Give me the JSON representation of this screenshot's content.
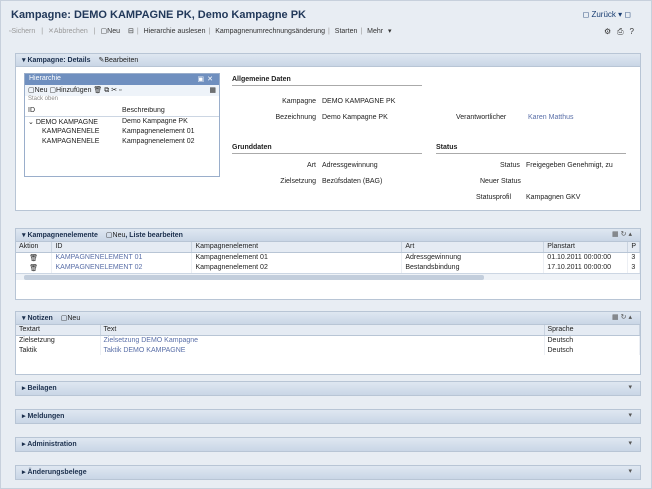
{
  "window": {
    "title": "Kampagne: DEMO KAMPAGNE PK, Demo Kampagne PK",
    "back_label": "Zurück"
  },
  "toolbar": {
    "items": [
      "Sichern",
      "Abbrechen",
      "Neu",
      "Hierarchie auslesen",
      "Kampagnenumrechnungsänderung",
      "Starten",
      "Mehr"
    ],
    "disabled": [
      true,
      true,
      false,
      false,
      false,
      false,
      false
    ]
  },
  "details": {
    "header": "Kampagne: Details",
    "edit": "Bearbeiten",
    "hierarchy": {
      "title": "Hierarchie",
      "new": "Neu",
      "add": "Hinzufügen",
      "stop": "Stack oben",
      "col_id": "ID",
      "col_desc": "Beschreibung",
      "rows": [
        {
          "id": "DEMO KAMPAGNE",
          "desc": "Demo Kampagne PK"
        },
        {
          "id": "KAMPAGNENELE",
          "desc": "Kampagnenelement 01"
        },
        {
          "id": "KAMPAGNENELE",
          "desc": "Kampagnenelement 02"
        }
      ]
    },
    "general": {
      "header": "Allgemeine Daten",
      "campaign_label": "Kampagne",
      "campaign_value": "DEMO KAMPAGNE PK",
      "desc_label": "Bezeichnung",
      "desc_value": "Demo Kampagne PK",
      "resp_label": "Verantwortlicher",
      "resp_value": "Karen Matthus"
    },
    "business": {
      "header": "Grunddaten",
      "type_label": "Art",
      "type_value": "Adressgewinnung",
      "target_label": "Zielsetzung",
      "target_value": "Bezüfsdaten (BAG)"
    },
    "status": {
      "header": "Status",
      "status_label": "Status",
      "status_value": "Freigegeben  Genehmigt, zu",
      "new_label": "Neuer Status",
      "new_value": "",
      "profile_label": "Statusprofil",
      "profile_value": "Kampagnen GKV"
    }
  },
  "elements": {
    "header": "Kampagnenelemente",
    "new": "Neu",
    "edit_list": "Liste bearbeiten",
    "columns": [
      "Aktion",
      "ID",
      "Kampagnenelement",
      "Art",
      "Planstart",
      "P"
    ],
    "rows": [
      {
        "id": "KAMPAGNENELEMENT 01",
        "name": "Kampagnenelement 01",
        "type": "Adressgewinnung",
        "start": "01.10.2011 00:00:00",
        "p": "3"
      },
      {
        "id": "KAMPAGNENELEMENT 02",
        "name": "Kampagnenelement 02",
        "type": "Bestandsbindung",
        "start": "17.10.2011 00:00:00",
        "p": "3"
      }
    ]
  },
  "notes": {
    "header": "Notizen",
    "new": "Neu",
    "columns": [
      "Textart",
      "Text",
      "Sprache"
    ],
    "rows": [
      {
        "type": "Zielsetzung",
        "text": "Zielsetzung DEMO Kampagne",
        "lang": "Deutsch"
      },
      {
        "type": "Taktik",
        "text": "Taktik DEMO KAMPAGNE",
        "lang": "Deutsch"
      }
    ]
  },
  "collapsed": [
    "Beilagen",
    "Meldungen",
    "Administration",
    "Änderungsbelege"
  ]
}
